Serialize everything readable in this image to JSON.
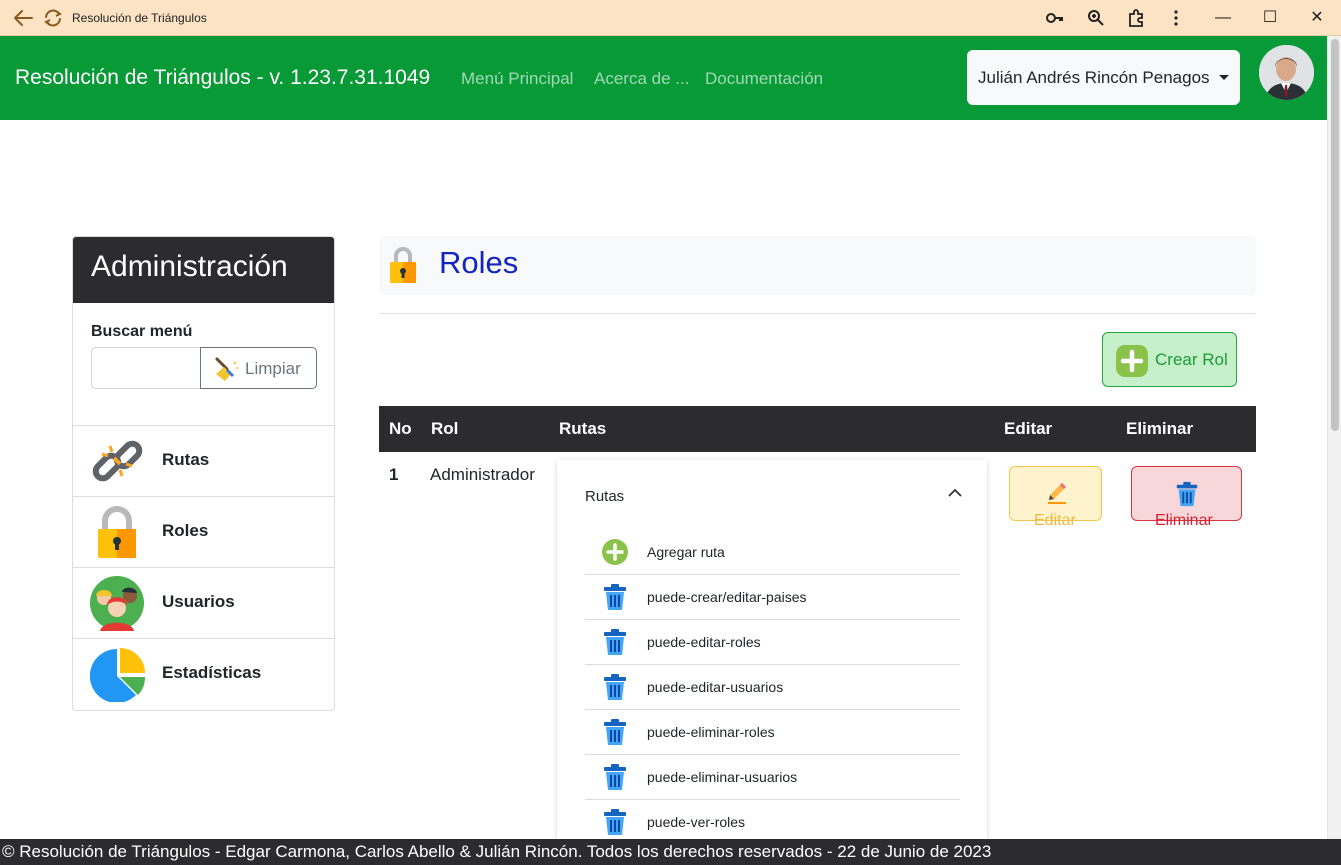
{
  "window": {
    "title": "Resolución de Triángulos",
    "minimize": "—",
    "maximize": "☐",
    "close": "✕"
  },
  "navbar": {
    "brand": "Resolución de Triángulos - v. 1.23.7.31.1049",
    "links": [
      "Menú Principal",
      "Acerca de ...",
      "Documentación"
    ],
    "user": "Julián Andrés Rincón Penagos"
  },
  "sidebar": {
    "title": "Administración",
    "search_label": "Buscar menú",
    "search_value": "",
    "clear_label": "Limpiar",
    "items": [
      {
        "label": "Rutas",
        "icon": "chain-link-icon"
      },
      {
        "label": "Roles",
        "icon": "padlock-icon"
      },
      {
        "label": "Usuarios",
        "icon": "users-icon"
      },
      {
        "label": "Estadísticas",
        "icon": "pie-chart-icon"
      }
    ]
  },
  "main": {
    "title": "Roles",
    "create_label": "Crear Rol",
    "table": {
      "headers": [
        "No",
        "Rol",
        "Rutas",
        "Editar",
        "Eliminar"
      ],
      "rows": [
        {
          "no": "1",
          "rol": "Administrador",
          "routes_header": "Rutas",
          "add_route": "Agregar ruta",
          "routes": [
            "puede-crear/editar-paises",
            "puede-editar-roles",
            "puede-editar-usuarios",
            "puede-eliminar-roles",
            "puede-eliminar-usuarios",
            "puede-ver-roles"
          ],
          "edit_label": "Editar",
          "delete_label": "Eliminar"
        }
      ]
    }
  },
  "colors": {
    "navbar": "#079a36",
    "dark": "#2c2c2f",
    "title_blue": "#1224c2"
  },
  "footer": "© Resolución de Triángulos - Edgar Carmona, Carlos Abello & Julián Rincón. Todos los derechos reservados - 22 de Junio de 2023"
}
